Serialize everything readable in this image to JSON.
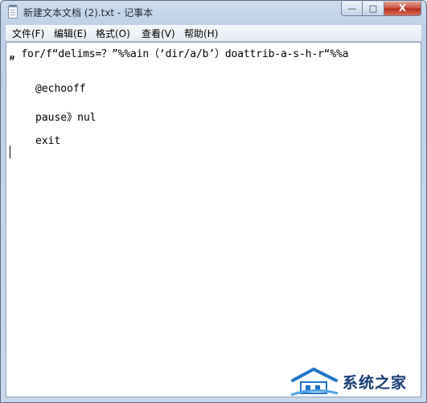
{
  "window": {
    "title": "新建文本文档 (2).txt - 记事本",
    "icon": "notepad-icon",
    "controls": {
      "minimize": "—",
      "maximize": "□",
      "close": "X"
    }
  },
  "menu": [
    {
      "label": "文件(F)"
    },
    {
      "label": "编辑(E)"
    },
    {
      "label": "格式(O)"
    },
    {
      "label": "查看(V)"
    },
    {
      "label": "帮助(H)"
    }
  ],
  "content": {
    "lines": [
      "„ for/f“delims=？”%%ain（‘dir/a/b’）doattrib-a-s-h-r“%%a",
      "”",
      "@echooff",
      "pause》nul",
      "exit"
    ]
  },
  "watermark": {
    "text": "系统之家",
    "icon": "house-logo-icon"
  }
}
